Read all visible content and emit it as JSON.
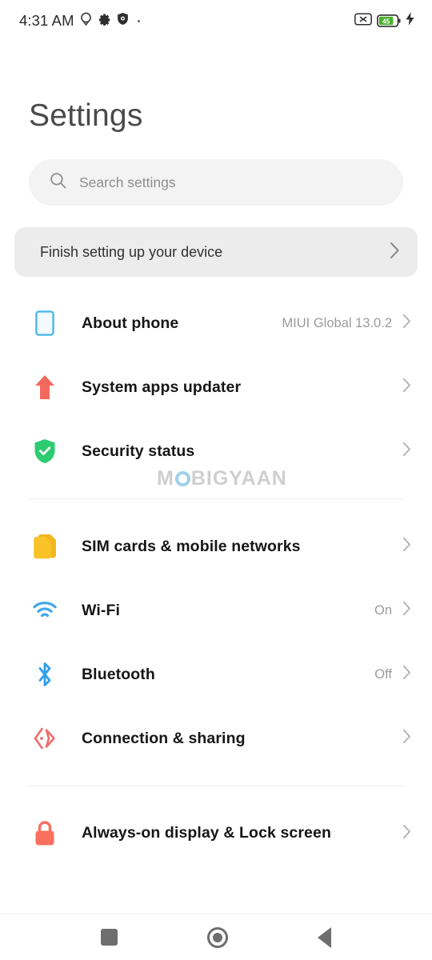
{
  "statusbar": {
    "time": "4:31 AM",
    "icons": [
      "location-pin-icon",
      "gear-icon",
      "shield-icon",
      "dot-indicator"
    ],
    "battery_percent": "45",
    "battery_charging": true,
    "silent_icon": "mute-icon",
    "battery_fill_color": "#4caf2f"
  },
  "header": {
    "title": "Settings"
  },
  "search": {
    "placeholder": "Search settings",
    "icon": "search-icon"
  },
  "banner": {
    "text": "Finish setting up your device",
    "chevron": "chevron-right-icon"
  },
  "groups": [
    {
      "rows": [
        {
          "label": "About phone",
          "value": "MIUI Global 13.0.2",
          "icon": "phone-outline-icon",
          "icon_color": "#4db8e8"
        },
        {
          "label": "System apps updater",
          "value": "",
          "icon": "arrow-up-icon",
          "icon_color": "#f4695e"
        },
        {
          "label": "Security status",
          "value": "",
          "icon": "shield-check-icon",
          "icon_color": "#2ecc71"
        }
      ]
    },
    {
      "rows": [
        {
          "label": "SIM cards & mobile networks",
          "value": "",
          "icon": "sim-card-icon",
          "icon_color": "#f9c228"
        },
        {
          "label": "Wi-Fi",
          "value": "On",
          "icon": "wifi-icon",
          "icon_color": "#44a8e8"
        },
        {
          "label": "Bluetooth",
          "value": "Off",
          "icon": "bluetooth-icon",
          "icon_color": "#2e9ff0"
        },
        {
          "label": "Connection & sharing",
          "value": "",
          "icon": "connection-sharing-icon",
          "icon_color": "#ef6d6d"
        }
      ]
    },
    {
      "rows": [
        {
          "label": "Always-on display & Lock screen",
          "value": "",
          "icon": "lock-icon",
          "icon_color": "#f9705f"
        }
      ]
    }
  ],
  "watermark": {
    "prefix": "M",
    "suffix": "BIGYAAN"
  },
  "navbar": {
    "recents": "recents-square-icon",
    "home": "home-circle-icon",
    "back": "back-triangle-icon"
  }
}
